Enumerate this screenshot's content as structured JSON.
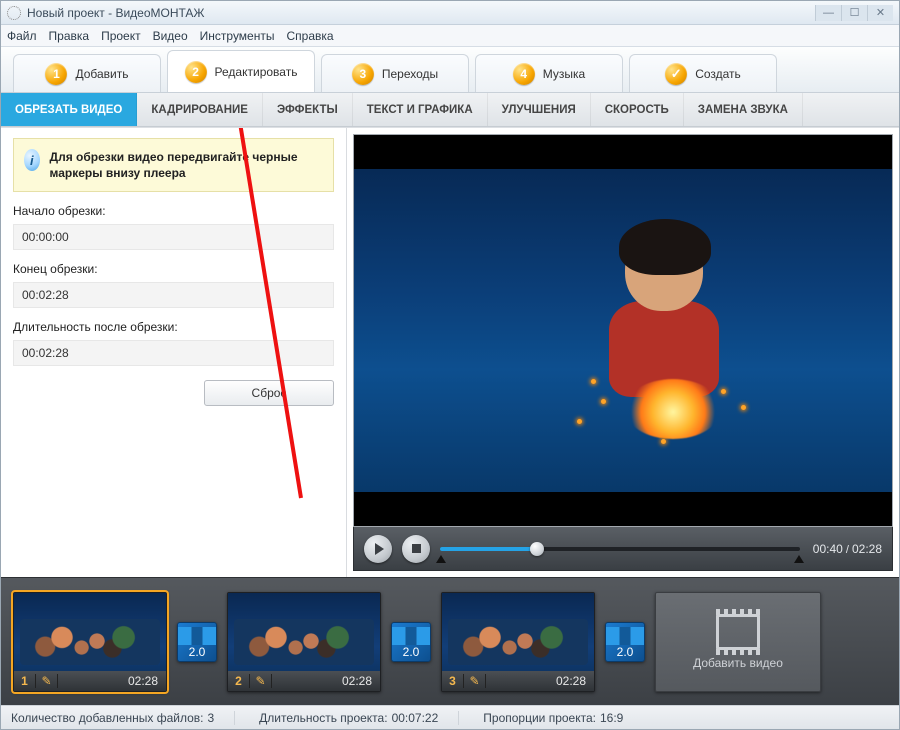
{
  "window": {
    "title": "Новый проект - ВидеоМОНТАЖ"
  },
  "menus": [
    "Файл",
    "Правка",
    "Проект",
    "Видео",
    "Инструменты",
    "Справка"
  ],
  "stages": [
    {
      "num": "1",
      "label": "Добавить"
    },
    {
      "num": "2",
      "label": "Редактировать"
    },
    {
      "num": "3",
      "label": "Переходы"
    },
    {
      "num": "4",
      "label": "Музыка"
    },
    {
      "check": true,
      "label": "Создать"
    }
  ],
  "active_stage_index": 1,
  "subtabs": [
    "ОБРЕЗАТЬ ВИДЕО",
    "КАДРИРОВАНИЕ",
    "ЭФФЕКТЫ",
    "ТЕКСТ И ГРАФИКА",
    "УЛУЧШЕНИЯ",
    "СКОРОСТЬ",
    "ЗАМЕНА ЗВУКА"
  ],
  "active_subtab_index": 0,
  "hint": "Для обрезки видео передвигайте черные маркеры внизу плеера",
  "trim": {
    "start_label": "Начало обрезки:",
    "start_value": "00:00:00",
    "end_label": "Конец обрезки:",
    "end_value": "00:02:28",
    "duration_label": "Длительность после обрезки:",
    "duration_value": "00:02:28",
    "reset_label": "Сброс"
  },
  "player": {
    "progress_percent": 27,
    "time_current": "00:40",
    "time_total": "02:28"
  },
  "timeline": {
    "clips": [
      {
        "index": "1",
        "duration": "02:28"
      },
      {
        "index": "2",
        "duration": "02:28"
      },
      {
        "index": "3",
        "duration": "02:28"
      }
    ],
    "transition_label": "2.0",
    "add_label": "Добавить видео",
    "selected_clip_index": 0
  },
  "status": {
    "files_label": "Количество добавленных файлов:",
    "files_value": "3",
    "duration_label": "Длительность проекта:",
    "duration_value": "00:07:22",
    "aspect_label": "Пропорции проекта:",
    "aspect_value": "16:9"
  }
}
